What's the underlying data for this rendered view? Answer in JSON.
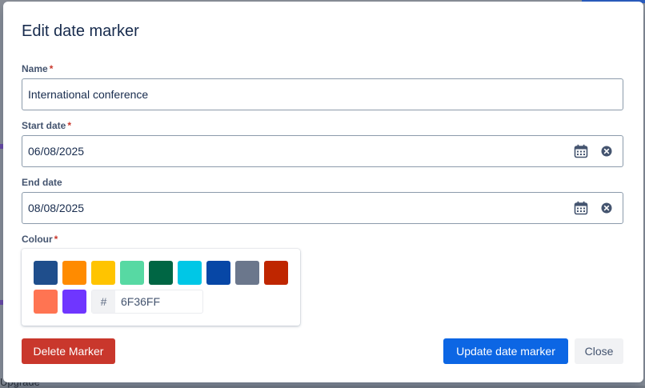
{
  "dialog": {
    "title": "Edit date marker"
  },
  "form": {
    "name": {
      "label": "Name",
      "required": "*",
      "value": "International conference"
    },
    "start_date": {
      "label": "Start date",
      "required": "*",
      "value": "06/08/2025"
    },
    "end_date": {
      "label": "End date",
      "value": "08/08/2025"
    },
    "colour": {
      "label": "Colour",
      "required": "*",
      "swatches": [
        "#1f4e8c",
        "#ff8b00",
        "#ffc400",
        "#57d9a3",
        "#006644",
        "#00c7e6",
        "#0747a6",
        "#6b778c",
        "#bf2600",
        "#ff7452",
        "#6f36ff"
      ],
      "hex_prefix": "#",
      "hex_value": "6F36FF"
    }
  },
  "buttons": {
    "delete": "Delete Marker",
    "update": "Update date marker",
    "close": "Close"
  },
  "icons": {
    "calendar": "calendar-icon",
    "clear": "clear-icon"
  },
  "background": {
    "partial_text": "Upgrade"
  }
}
